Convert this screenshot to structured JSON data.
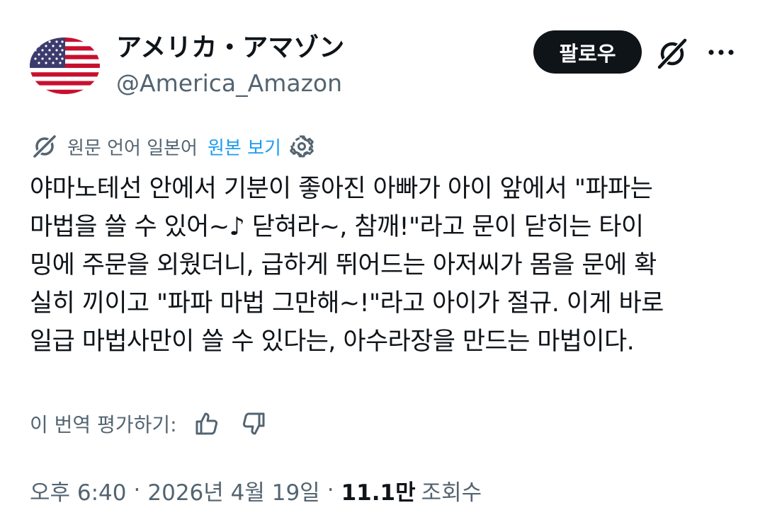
{
  "author": {
    "display_name": "アメリカ・アマゾン",
    "handle": "@America_Amazon",
    "avatar": "us-flag-avatar"
  },
  "header": {
    "follow_label": "팔로우",
    "grok_icon": "grok-icon",
    "more_icon": "more-icon"
  },
  "translation": {
    "note": "원문 언어 일본어",
    "show_original": "원본 보기",
    "settings_icon": "gear-icon"
  },
  "post": {
    "text": "야마노테선 안에서 기분이 좋아진 아빠가 아이 앞에서 \"파파는\n마법을 쓸 수 있어~♪ 닫혀라~, 참깨!\"라고 문이 닫히는 타이\n밍에 주문을 외웠더니, 급하게 뛰어드는 아저씨가 몸을 문에 확\n실히 끼이고 \"파파 마법 그만해~!\"라고 아이가 절규. 이게 바로\n일급 마법사만이 쓸 수 있다는, 아수라장을 만드는 마법이다."
  },
  "rating": {
    "label": "이 번역 평가하기:",
    "like_icon": "thumbs-up-icon",
    "dislike_icon": "thumbs-down-icon"
  },
  "meta": {
    "time": "오후 6:40",
    "separator": "·",
    "date": "2026년 4월 19일",
    "views_count": "11.1만",
    "views_label": "조회수"
  },
  "colors": {
    "text": "#0f1419",
    "secondary": "#536471",
    "link": "#1d9bf0",
    "button_bg": "#0f1419"
  }
}
